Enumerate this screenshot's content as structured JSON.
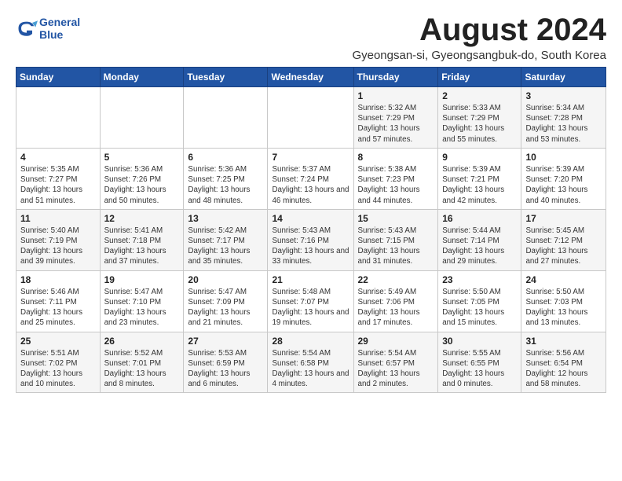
{
  "logo": {
    "line1": "General",
    "line2": "Blue"
  },
  "title": "August 2024",
  "subtitle": "Gyeongsan-si, Gyeongsangbuk-do, South Korea",
  "headers": [
    "Sunday",
    "Monday",
    "Tuesday",
    "Wednesday",
    "Thursday",
    "Friday",
    "Saturday"
  ],
  "weeks": [
    [
      {
        "day": "",
        "info": ""
      },
      {
        "day": "",
        "info": ""
      },
      {
        "day": "",
        "info": ""
      },
      {
        "day": "",
        "info": ""
      },
      {
        "day": "1",
        "info": "Sunrise: 5:32 AM\nSunset: 7:29 PM\nDaylight: 13 hours and 57 minutes."
      },
      {
        "day": "2",
        "info": "Sunrise: 5:33 AM\nSunset: 7:29 PM\nDaylight: 13 hours and 55 minutes."
      },
      {
        "day": "3",
        "info": "Sunrise: 5:34 AM\nSunset: 7:28 PM\nDaylight: 13 hours and 53 minutes."
      }
    ],
    [
      {
        "day": "4",
        "info": "Sunrise: 5:35 AM\nSunset: 7:27 PM\nDaylight: 13 hours and 51 minutes."
      },
      {
        "day": "5",
        "info": "Sunrise: 5:36 AM\nSunset: 7:26 PM\nDaylight: 13 hours and 50 minutes."
      },
      {
        "day": "6",
        "info": "Sunrise: 5:36 AM\nSunset: 7:25 PM\nDaylight: 13 hours and 48 minutes."
      },
      {
        "day": "7",
        "info": "Sunrise: 5:37 AM\nSunset: 7:24 PM\nDaylight: 13 hours and 46 minutes."
      },
      {
        "day": "8",
        "info": "Sunrise: 5:38 AM\nSunset: 7:23 PM\nDaylight: 13 hours and 44 minutes."
      },
      {
        "day": "9",
        "info": "Sunrise: 5:39 AM\nSunset: 7:21 PM\nDaylight: 13 hours and 42 minutes."
      },
      {
        "day": "10",
        "info": "Sunrise: 5:39 AM\nSunset: 7:20 PM\nDaylight: 13 hours and 40 minutes."
      }
    ],
    [
      {
        "day": "11",
        "info": "Sunrise: 5:40 AM\nSunset: 7:19 PM\nDaylight: 13 hours and 39 minutes."
      },
      {
        "day": "12",
        "info": "Sunrise: 5:41 AM\nSunset: 7:18 PM\nDaylight: 13 hours and 37 minutes."
      },
      {
        "day": "13",
        "info": "Sunrise: 5:42 AM\nSunset: 7:17 PM\nDaylight: 13 hours and 35 minutes."
      },
      {
        "day": "14",
        "info": "Sunrise: 5:43 AM\nSunset: 7:16 PM\nDaylight: 13 hours and 33 minutes."
      },
      {
        "day": "15",
        "info": "Sunrise: 5:43 AM\nSunset: 7:15 PM\nDaylight: 13 hours and 31 minutes."
      },
      {
        "day": "16",
        "info": "Sunrise: 5:44 AM\nSunset: 7:14 PM\nDaylight: 13 hours and 29 minutes."
      },
      {
        "day": "17",
        "info": "Sunrise: 5:45 AM\nSunset: 7:12 PM\nDaylight: 13 hours and 27 minutes."
      }
    ],
    [
      {
        "day": "18",
        "info": "Sunrise: 5:46 AM\nSunset: 7:11 PM\nDaylight: 13 hours and 25 minutes."
      },
      {
        "day": "19",
        "info": "Sunrise: 5:47 AM\nSunset: 7:10 PM\nDaylight: 13 hours and 23 minutes."
      },
      {
        "day": "20",
        "info": "Sunrise: 5:47 AM\nSunset: 7:09 PM\nDaylight: 13 hours and 21 minutes."
      },
      {
        "day": "21",
        "info": "Sunrise: 5:48 AM\nSunset: 7:07 PM\nDaylight: 13 hours and 19 minutes."
      },
      {
        "day": "22",
        "info": "Sunrise: 5:49 AM\nSunset: 7:06 PM\nDaylight: 13 hours and 17 minutes."
      },
      {
        "day": "23",
        "info": "Sunrise: 5:50 AM\nSunset: 7:05 PM\nDaylight: 13 hours and 15 minutes."
      },
      {
        "day": "24",
        "info": "Sunrise: 5:50 AM\nSunset: 7:03 PM\nDaylight: 13 hours and 13 minutes."
      }
    ],
    [
      {
        "day": "25",
        "info": "Sunrise: 5:51 AM\nSunset: 7:02 PM\nDaylight: 13 hours and 10 minutes."
      },
      {
        "day": "26",
        "info": "Sunrise: 5:52 AM\nSunset: 7:01 PM\nDaylight: 13 hours and 8 minutes."
      },
      {
        "day": "27",
        "info": "Sunrise: 5:53 AM\nSunset: 6:59 PM\nDaylight: 13 hours and 6 minutes."
      },
      {
        "day": "28",
        "info": "Sunrise: 5:54 AM\nSunset: 6:58 PM\nDaylight: 13 hours and 4 minutes."
      },
      {
        "day": "29",
        "info": "Sunrise: 5:54 AM\nSunset: 6:57 PM\nDaylight: 13 hours and 2 minutes."
      },
      {
        "day": "30",
        "info": "Sunrise: 5:55 AM\nSunset: 6:55 PM\nDaylight: 13 hours and 0 minutes."
      },
      {
        "day": "31",
        "info": "Sunrise: 5:56 AM\nSunset: 6:54 PM\nDaylight: 12 hours and 58 minutes."
      }
    ]
  ]
}
